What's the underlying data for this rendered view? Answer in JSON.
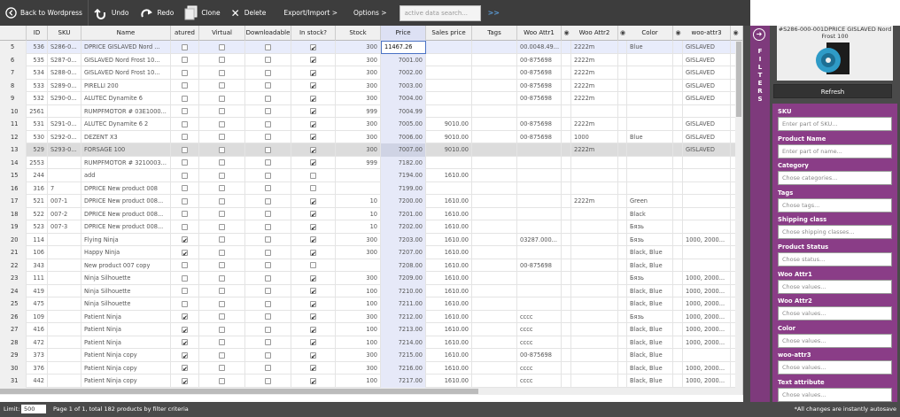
{
  "toolbar": {
    "back_label": "Back to Wordpress",
    "undo_label": "Undo",
    "redo_label": "Redo",
    "clone_label": "Clone",
    "delete_label": "Delete",
    "export_label": "Export/Import >",
    "options_label": "Options >",
    "search_placeholder": "active data search...",
    "arrows": ">>"
  },
  "columns": [
    {
      "key": "rn",
      "label": ""
    },
    {
      "key": "id",
      "label": "ID"
    },
    {
      "key": "sku",
      "label": "SKU"
    },
    {
      "key": "name",
      "label": "Name"
    },
    {
      "key": "featured",
      "label": "atured"
    },
    {
      "key": "virtual",
      "label": "Virtual"
    },
    {
      "key": "downloadable",
      "label": "Downloadable"
    },
    {
      "key": "instock",
      "label": "In stock?"
    },
    {
      "key": "stock",
      "label": "Stock"
    },
    {
      "key": "price",
      "label": "Price"
    },
    {
      "key": "sale",
      "label": "Sales price"
    },
    {
      "key": "tags",
      "label": "Tags"
    },
    {
      "key": "attr1",
      "label": "Woo Attr1"
    },
    {
      "key": "attr2",
      "label": "Woo Attr2"
    },
    {
      "key": "color",
      "label": "Color"
    },
    {
      "key": "wattr3",
      "label": "woo-attr3"
    }
  ],
  "rows": [
    {
      "rn": "5",
      "id": "536",
      "sku": "S286-0...",
      "name": "DPRICE GISLAVED Nord ...",
      "f": false,
      "v": false,
      "d": false,
      "s": true,
      "stock": "300",
      "price": "11467.26",
      "sale": "",
      "tags": "",
      "a1": "00.0048.49...",
      "a2": "2222m",
      "color": "Blue",
      "w3": "GISLAVED",
      "state": "sel"
    },
    {
      "rn": "6",
      "id": "535",
      "sku": "S287-0...",
      "name": "GISLAVED Nord Frost 10...",
      "f": false,
      "v": false,
      "d": false,
      "s": true,
      "stock": "300",
      "price": "7001.00",
      "sale": "",
      "tags": "",
      "a1": "00-875698",
      "a2": "2222m",
      "color": "",
      "w3": "GISLAVED",
      "state": ""
    },
    {
      "rn": "7",
      "id": "534",
      "sku": "S288-0...",
      "name": "GISLAVED Nord Frost 10...",
      "f": false,
      "v": false,
      "d": false,
      "s": true,
      "stock": "300",
      "price": "7002.00",
      "sale": "",
      "tags": "",
      "a1": "00-875698",
      "a2": "2222m",
      "color": "",
      "w3": "GISLAVED",
      "state": ""
    },
    {
      "rn": "8",
      "id": "533",
      "sku": "S289-0...",
      "name": "PIRELLI 200",
      "f": false,
      "v": false,
      "d": false,
      "s": true,
      "stock": "300",
      "price": "7003.00",
      "sale": "",
      "tags": "",
      "a1": "00-875698",
      "a2": "2222m",
      "color": "",
      "w3": "GISLAVED",
      "state": ""
    },
    {
      "rn": "9",
      "id": "532",
      "sku": "S290-0...",
      "name": "ALUTEC Dynamite 6",
      "f": false,
      "v": false,
      "d": false,
      "s": true,
      "stock": "300",
      "price": "7004.00",
      "sale": "",
      "tags": "",
      "a1": "00-875698",
      "a2": "2222m",
      "color": "",
      "w3": "GISLAVED",
      "state": ""
    },
    {
      "rn": "10",
      "id": "2561",
      "sku": "",
      "name": "RUMPFMOTOR # 03E1000...",
      "f": false,
      "v": false,
      "d": false,
      "s": true,
      "stock": "999",
      "price": "7004.99",
      "sale": "",
      "tags": "",
      "a1": "",
      "a2": "",
      "color": "",
      "w3": "",
      "state": ""
    },
    {
      "rn": "11",
      "id": "531",
      "sku": "S291-0...",
      "name": "ALUTEC Dynamite 6 2",
      "f": false,
      "v": false,
      "d": false,
      "s": true,
      "stock": "300",
      "price": "7005.00",
      "sale": "9010.00",
      "tags": "",
      "a1": "00-875698",
      "a2": "2222m",
      "color": "",
      "w3": "GISLAVED",
      "state": ""
    },
    {
      "rn": "12",
      "id": "530",
      "sku": "S292-0...",
      "name": "DEZENT X3",
      "f": false,
      "v": false,
      "d": false,
      "s": true,
      "stock": "300",
      "price": "7006.00",
      "sale": "9010.00",
      "tags": "",
      "a1": "00-875698",
      "a2": "1000",
      "color": "Blue",
      "w3": "GISLAVED",
      "state": ""
    },
    {
      "rn": "13",
      "id": "529",
      "sku": "S293-0...",
      "name": "FORSAGE 100",
      "f": false,
      "v": false,
      "d": false,
      "s": true,
      "stock": "300",
      "price": "7007.00",
      "sale": "9010.00",
      "tags": "",
      "a1": "",
      "a2": "2222m",
      "color": "",
      "w3": "GISLAVED",
      "state": "grey"
    },
    {
      "rn": "14",
      "id": "2553",
      "sku": "",
      "name": "RUMPFMOTOR # 3210003...",
      "f": false,
      "v": false,
      "d": false,
      "s": true,
      "stock": "999",
      "price": "7182.00",
      "sale": "",
      "tags": "",
      "a1": "",
      "a2": "",
      "color": "",
      "w3": "",
      "state": ""
    },
    {
      "rn": "15",
      "id": "244",
      "sku": "",
      "name": "add",
      "f": false,
      "v": false,
      "d": false,
      "s": false,
      "stock": "",
      "price": "7194.00",
      "sale": "1610.00",
      "tags": "",
      "a1": "",
      "a2": "",
      "color": "",
      "w3": "",
      "state": ""
    },
    {
      "rn": "16",
      "id": "316",
      "sku": "7",
      "name": "DPRICE New product 008",
      "f": false,
      "v": false,
      "d": false,
      "s": false,
      "stock": "",
      "price": "7199.00",
      "sale": "",
      "tags": "",
      "a1": "",
      "a2": "",
      "color": "",
      "w3": "",
      "state": ""
    },
    {
      "rn": "17",
      "id": "521",
      "sku": "007-1",
      "name": "DPRICE New product 008...",
      "f": false,
      "v": false,
      "d": false,
      "s": true,
      "stock": "10",
      "price": "7200.00",
      "sale": "1610.00",
      "tags": "",
      "a1": "",
      "a2": "2222m",
      "color": "Green",
      "w3": "",
      "state": ""
    },
    {
      "rn": "18",
      "id": "522",
      "sku": "007-2",
      "name": "DPRICE New product 008...",
      "f": false,
      "v": false,
      "d": false,
      "s": true,
      "stock": "10",
      "price": "7201.00",
      "sale": "1610.00",
      "tags": "",
      "a1": "",
      "a2": "",
      "color": "Black",
      "w3": "",
      "state": ""
    },
    {
      "rn": "19",
      "id": "523",
      "sku": "007-3",
      "name": "DPRICE New product 008...",
      "f": false,
      "v": false,
      "d": false,
      "s": true,
      "stock": "10",
      "price": "7202.00",
      "sale": "1610.00",
      "tags": "",
      "a1": "",
      "a2": "",
      "color": "Бязь",
      "w3": "",
      "state": ""
    },
    {
      "rn": "20",
      "id": "114",
      "sku": "",
      "name": "Flying Ninja",
      "f": true,
      "v": false,
      "d": false,
      "s": true,
      "stock": "300",
      "price": "7203.00",
      "sale": "1610.00",
      "tags": "",
      "a1": "03287.000...",
      "a2": "",
      "color": "Бязь",
      "w3": "1000, 2000...",
      "state": ""
    },
    {
      "rn": "21",
      "id": "106",
      "sku": "",
      "name": "Happy Ninja",
      "f": true,
      "v": false,
      "d": false,
      "s": true,
      "stock": "300",
      "price": "7207.00",
      "sale": "1610.00",
      "tags": "",
      "a1": "",
      "a2": "",
      "color": "Black, Blue",
      "w3": "",
      "state": ""
    },
    {
      "rn": "22",
      "id": "343",
      "sku": "",
      "name": "New product 007 copy",
      "f": false,
      "v": false,
      "d": false,
      "s": false,
      "stock": "",
      "price": "7208.00",
      "sale": "1610.00",
      "tags": "",
      "a1": "00-875698",
      "a2": "",
      "color": "Black, Blue",
      "w3": "",
      "state": ""
    },
    {
      "rn": "23",
      "id": "111",
      "sku": "",
      "name": "Ninja Silhouette",
      "f": false,
      "v": false,
      "d": false,
      "s": true,
      "stock": "300",
      "price": "7209.00",
      "sale": "1610.00",
      "tags": "",
      "a1": "",
      "a2": "",
      "color": "Бязь",
      "w3": "1000, 2000...",
      "state": ""
    },
    {
      "rn": "24",
      "id": "419",
      "sku": "",
      "name": "Ninja Silhouette",
      "f": false,
      "v": false,
      "d": false,
      "s": true,
      "stock": "100",
      "price": "7210.00",
      "sale": "1610.00",
      "tags": "",
      "a1": "",
      "a2": "",
      "color": "Black, Blue",
      "w3": "1000, 2000...",
      "state": ""
    },
    {
      "rn": "25",
      "id": "475",
      "sku": "",
      "name": "Ninja Silhouette",
      "f": false,
      "v": false,
      "d": false,
      "s": true,
      "stock": "100",
      "price": "7211.00",
      "sale": "1610.00",
      "tags": "",
      "a1": "",
      "a2": "",
      "color": "Black, Blue",
      "w3": "1000, 2000...",
      "state": ""
    },
    {
      "rn": "26",
      "id": "109",
      "sku": "",
      "name": "Patient Ninja",
      "f": true,
      "v": false,
      "d": false,
      "s": true,
      "stock": "300",
      "price": "7212.00",
      "sale": "1610.00",
      "tags": "",
      "a1": "cccc",
      "a2": "",
      "color": "Бязь",
      "w3": "1000, 2000...",
      "state": ""
    },
    {
      "rn": "27",
      "id": "416",
      "sku": "",
      "name": "Patient Ninja",
      "f": true,
      "v": false,
      "d": false,
      "s": true,
      "stock": "100",
      "price": "7213.00",
      "sale": "1610.00",
      "tags": "",
      "a1": "cccc",
      "a2": "",
      "color": "Black, Blue",
      "w3": "1000, 2000...",
      "state": ""
    },
    {
      "rn": "28",
      "id": "472",
      "sku": "",
      "name": "Patient Ninja",
      "f": true,
      "v": false,
      "d": false,
      "s": true,
      "stock": "100",
      "price": "7214.00",
      "sale": "1610.00",
      "tags": "",
      "a1": "cccc",
      "a2": "",
      "color": "Black, Blue",
      "w3": "1000, 2000...",
      "state": ""
    },
    {
      "rn": "29",
      "id": "373",
      "sku": "",
      "name": "Patient Ninja copy",
      "f": true,
      "v": false,
      "d": false,
      "s": true,
      "stock": "300",
      "price": "7215.00",
      "sale": "1610.00",
      "tags": "",
      "a1": "00-875698",
      "a2": "",
      "color": "Black, Blue",
      "w3": "",
      "state": ""
    },
    {
      "rn": "30",
      "id": "376",
      "sku": "",
      "name": "Patient Ninja copy",
      "f": true,
      "v": false,
      "d": false,
      "s": true,
      "stock": "300",
      "price": "7216.00",
      "sale": "1610.00",
      "tags": "",
      "a1": "cccc",
      "a2": "",
      "color": "Black, Blue",
      "w3": "1000, 2000...",
      "state": ""
    },
    {
      "rn": "31",
      "id": "442",
      "sku": "",
      "name": "Patient Ninja copy",
      "f": true,
      "v": false,
      "d": false,
      "s": true,
      "stock": "100",
      "price": "7217.00",
      "sale": "1610.00",
      "tags": "",
      "a1": "cccc",
      "a2": "",
      "color": "Black, Blue",
      "w3": "1000, 2000...",
      "state": ""
    }
  ],
  "filters_tab": "FILTERS",
  "preview_title": "#S286-000-001DPRICE GISLAVED Nord Frost 100",
  "refresh_label": "Refresh",
  "filters": [
    {
      "label": "SKU",
      "placeholder": "Enter part of SKU..."
    },
    {
      "label": "Product Name",
      "placeholder": "Enter part of name..."
    },
    {
      "label": "Category",
      "placeholder": "Chose categories..."
    },
    {
      "label": "Tags",
      "placeholder": "Chose tags..."
    },
    {
      "label": "Shipping class",
      "placeholder": "Chose shipping classes..."
    },
    {
      "label": "Product Status",
      "placeholder": "Chose status..."
    },
    {
      "label": "Woo Attr1",
      "placeholder": "Chose values..."
    },
    {
      "label": "Woo Attr2",
      "placeholder": "Chose values..."
    },
    {
      "label": "Color",
      "placeholder": "Chose values..."
    },
    {
      "label": "woo-attr3",
      "placeholder": "Chose values..."
    },
    {
      "label": "Text attribute",
      "placeholder": "Chose values..."
    }
  ],
  "footer": {
    "limit_label": "Limit:",
    "limit_value": "500",
    "info": "Page 1 of 1, total 182 products by filter criteria",
    "note": "*All changes are instantly autosave"
  },
  "colors": {
    "toolbar": "#3d3d3d",
    "filters_purple": "#8a3d87",
    "price_col": "#e6e9f8",
    "selected_row": "#e8ecfb"
  }
}
